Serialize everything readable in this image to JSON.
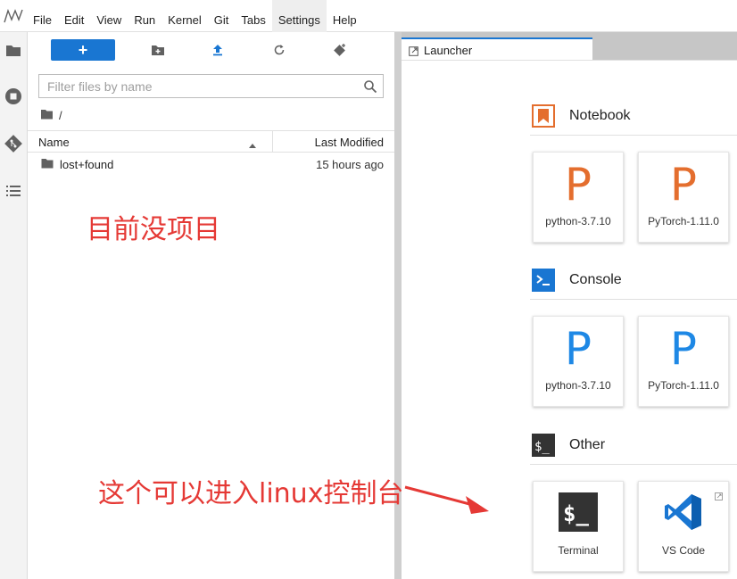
{
  "menubar": {
    "items": [
      "File",
      "Edit",
      "View",
      "Run",
      "Kernel",
      "Git",
      "Tabs",
      "Settings",
      "Help"
    ],
    "active": "Settings"
  },
  "filebrowser": {
    "new_label": "+",
    "filter_placeholder": "Filter files by name",
    "breadcrumb_sep": "/",
    "columns": {
      "name": "Name",
      "modified": "Last Modified"
    },
    "rows": [
      {
        "name": "lost+found",
        "modified": "15 hours ago"
      }
    ]
  },
  "annotations": {
    "empty_note": "目前没项目",
    "terminal_note": "这个可以进入linux控制台"
  },
  "tabs": [
    {
      "label": "Launcher"
    }
  ],
  "launcher": {
    "sections": [
      {
        "title": "Notebook",
        "cards": [
          {
            "letter": "P",
            "label": "python-3.7.10"
          },
          {
            "letter": "P",
            "label": "PyTorch-1.11.0"
          }
        ]
      },
      {
        "title": "Console",
        "cards": [
          {
            "letter": "P",
            "label": "python-3.7.10"
          },
          {
            "letter": "P",
            "label": "PyTorch-1.11.0"
          }
        ]
      },
      {
        "title": "Other",
        "cards": [
          {
            "label": "Terminal"
          },
          {
            "label": "VS Code"
          }
        ]
      }
    ]
  },
  "colors": {
    "accent": "#1976d2",
    "notebook_orange": "#e46e2e",
    "console_blue": "#1e88e5",
    "annotation_red": "#e53935"
  }
}
